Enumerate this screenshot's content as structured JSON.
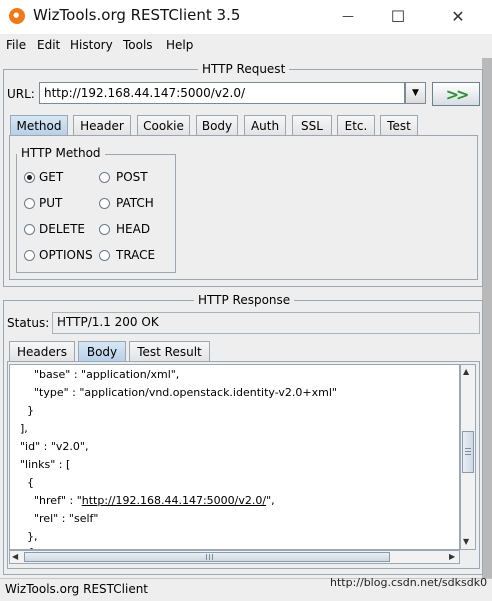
{
  "window": {
    "title": "WizTools.org RESTClient 3.5",
    "minimize": "—",
    "maximize": "☐",
    "close": "✕"
  },
  "menu": [
    "File",
    "Edit",
    "History",
    "Tools",
    "Help"
  ],
  "request": {
    "group_title": "HTTP Request",
    "url_label": "URL:",
    "url_value": "http://192.168.44.147:5000/v2.0/",
    "go_symbol": ">>",
    "tabs": [
      "Method",
      "Header",
      "Cookie",
      "Body",
      "Auth",
      "SSL",
      "Etc.",
      "Test"
    ],
    "active_tab": "Method",
    "method_group_title": "HTTP Method",
    "methods": [
      "GET",
      "POST",
      "PUT",
      "PATCH",
      "DELETE",
      "HEAD",
      "OPTIONS",
      "TRACE"
    ],
    "selected_method": "GET"
  },
  "response": {
    "group_title": "HTTP Response",
    "status_label": "Status:",
    "status_value": "HTTP/1.1 200 OK",
    "tabs": [
      "Headers",
      "Body",
      "Test Result"
    ],
    "active_tab": "Body",
    "body_lines": [
      "    \"base\" : \"application/xml\",",
      "    \"type\" : \"application/vnd.openstack.identity-v2.0+xml\"",
      "  }",
      "],",
      "\"id\" : \"v2.0\",",
      "\"links\" : [",
      "  {",
      "    \"href\" : \"http://192.168.44.147:5000/v2.0/\",",
      "    \"rel\" : \"self\"",
      "  },",
      "  {"
    ]
  },
  "statusbar": {
    "text": "WizTools.org RESTClient",
    "watermark": "http://blog.csdn.net/sdksdk0"
  }
}
